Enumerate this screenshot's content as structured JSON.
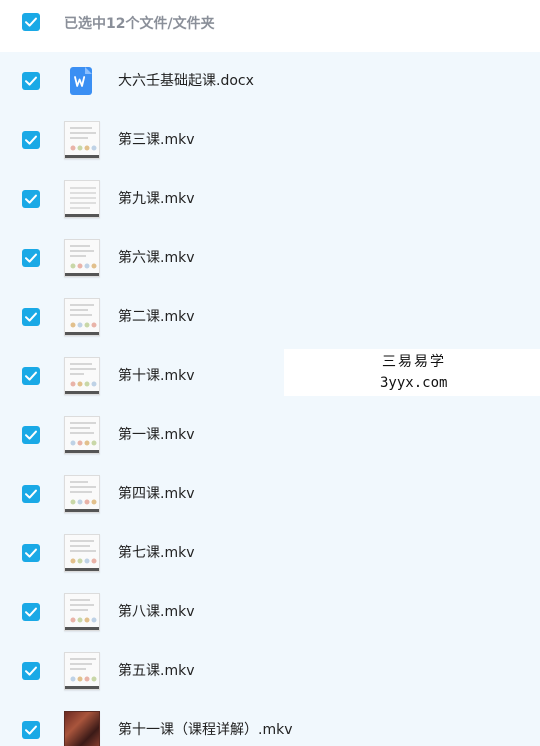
{
  "header": {
    "selection_text": "已选中12个文件/文件夹"
  },
  "files": [
    {
      "name": "大六壬基础起课.docx",
      "icon": "word-doc-icon"
    },
    {
      "name": "第三课.mkv",
      "icon": "video-thumbnail"
    },
    {
      "name": "第九课.mkv",
      "icon": "video-thumbnail"
    },
    {
      "name": "第六课.mkv",
      "icon": "video-thumbnail"
    },
    {
      "name": "第二课.mkv",
      "icon": "video-thumbnail"
    },
    {
      "name": "第十课.mkv",
      "icon": "video-thumbnail"
    },
    {
      "name": "第一课.mkv",
      "icon": "video-thumbnail"
    },
    {
      "name": "第四课.mkv",
      "icon": "video-thumbnail"
    },
    {
      "name": "第七课.mkv",
      "icon": "video-thumbnail"
    },
    {
      "name": "第八课.mkv",
      "icon": "video-thumbnail"
    },
    {
      "name": "第五课.mkv",
      "icon": "video-thumbnail"
    },
    {
      "name": "第十一课（课程详解）.mkv",
      "icon": "video-thumbnail"
    }
  ],
  "watermark": {
    "line1": "三易易学",
    "line2": "3yyx.com"
  },
  "colors": {
    "checkbox": "#1aa9e6",
    "list_background": "#f1f8fd",
    "word_icon": "#3b8ff3"
  }
}
